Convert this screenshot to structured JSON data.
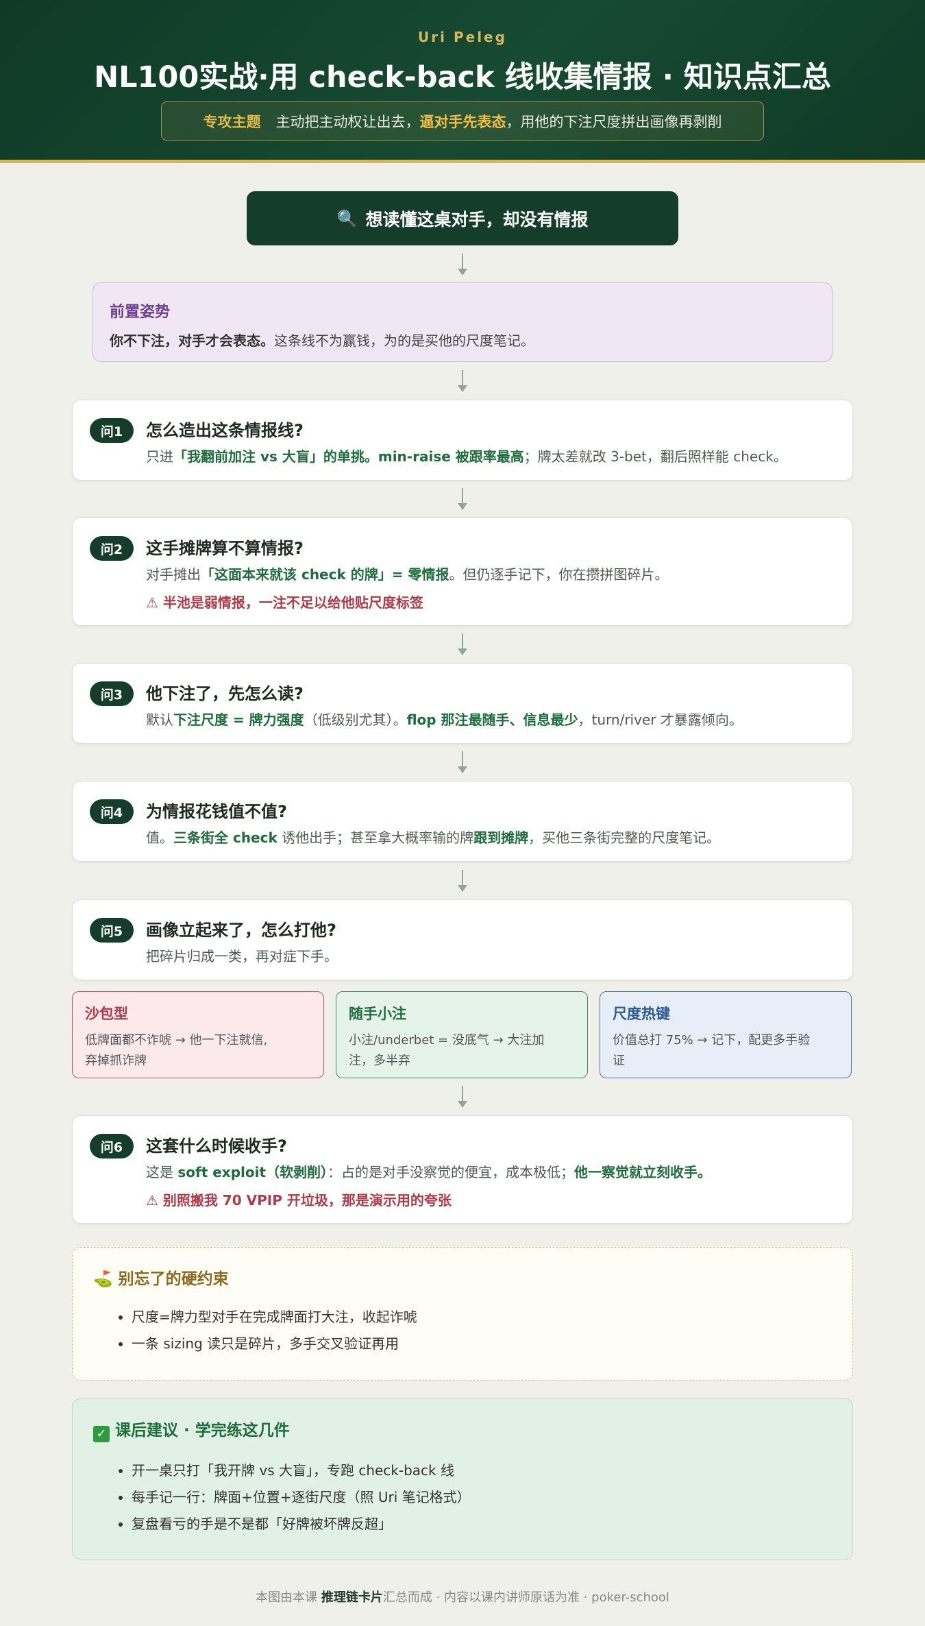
{
  "header": {
    "author": "Uri Peleg",
    "title": "NL100实战·用 check-back 线收集情报 · 知识点汇总",
    "subject_tag": "专攻主题",
    "subject_pre": "主动把主动权让出去，",
    "subject_hl": "逼对手先表态",
    "subject_post": "，用他的下注尺度拼出画像再剥削"
  },
  "start_label": "想读懂这桌对手，却没有情报",
  "premise": {
    "heading": "前置姿势",
    "bold": "你不下注，对手才会表态。",
    "rest": "这条线不为赢钱，为的是买他的尺度笔记。"
  },
  "q1": {
    "badge": "问1",
    "question": "怎么造出这条情报线?",
    "a_pre": "只进",
    "a_g1": "「我翻前加注 vs 大盲」的单挑。min-raise 被跟率最高",
    "a_post": "；牌太差就改 3-bet，翻后照样能 check。"
  },
  "q2": {
    "badge": "问2",
    "question": "这手摊牌算不算情报?",
    "a_pre": "对手摊出",
    "a_g1": "「这面本来就该 check 的牌」= 零情报",
    "a_post": "。但仍逐手记下，你在攒拼图碎片。",
    "warning": "⚠ 半池是弱情报，一注不足以给他贴尺度标签"
  },
  "q3": {
    "badge": "问3",
    "question": "他下注了，先怎么读?",
    "a_pre": "默认",
    "a_g1": "下注尺度 = 牌力强度",
    "a_mid": "（低级别尤其）。",
    "a_g2": "flop 那注最随手、信息最少",
    "a_post": "，turn/river 才暴露倾向。"
  },
  "q4": {
    "badge": "问4",
    "question": "为情报花钱值不值?",
    "a_pre": "值。",
    "a_g1": "三条街全 check",
    "a_mid": " 诱他出手；甚至拿大概率输的牌",
    "a_g2": "跟到摊牌",
    "a_post": "，买他三条街完整的尺度笔记。"
  },
  "q5": {
    "badge": "问5",
    "question": "画像立起来了，怎么打他?",
    "answer": "把碎片归成一类，再对症下手。"
  },
  "types": [
    {
      "heading": "沙包型",
      "line1": "低牌面都不诈唬 → 他一下注就信,",
      "line2": "弃掉抓诈牌"
    },
    {
      "heading": "随手小注",
      "line1": "小注/underbet = 没底气 → 大注加",
      "line2": "注，多半弃"
    },
    {
      "heading": "尺度热键",
      "line1": "价值总打 75% → 记下，配更多手验",
      "line2": "证"
    }
  ],
  "q6": {
    "badge": "问6",
    "question": "这套什么时候收手?",
    "a_pre": "这是 ",
    "a_g1": "soft exploit（软剥削）",
    "a_mid": "：占的是对手没察觉的便宜，成本极低；",
    "a_g2": "他一察觉就立刻收手。",
    "warning": "⚠ 别照搬我 70 VPIP 开垃圾，那是演示用的夸张"
  },
  "constraints": {
    "heading": "别忘了的硬约束",
    "items": [
      "尺度=牌力型对手在完成牌面打大注，收起诈唬",
      "一条 sizing 读只是碎片，多手交叉验证再用"
    ]
  },
  "advice": {
    "heading": "课后建议 · 学完练这几件",
    "items": [
      "开一桌只打「我开牌 vs 大盲」，专跑 check-back 线",
      "每手记一行：牌面+位置+逐街尺度（照 Uri 笔记格式）",
      "复盘看亏的手是不是都「好牌被坏牌反超」"
    ]
  },
  "footer": {
    "pre": "本图由本课 ",
    "bold": "推理链卡片",
    "post": "汇总而成 · 内容以课内讲师原话为准 · poker-school"
  }
}
